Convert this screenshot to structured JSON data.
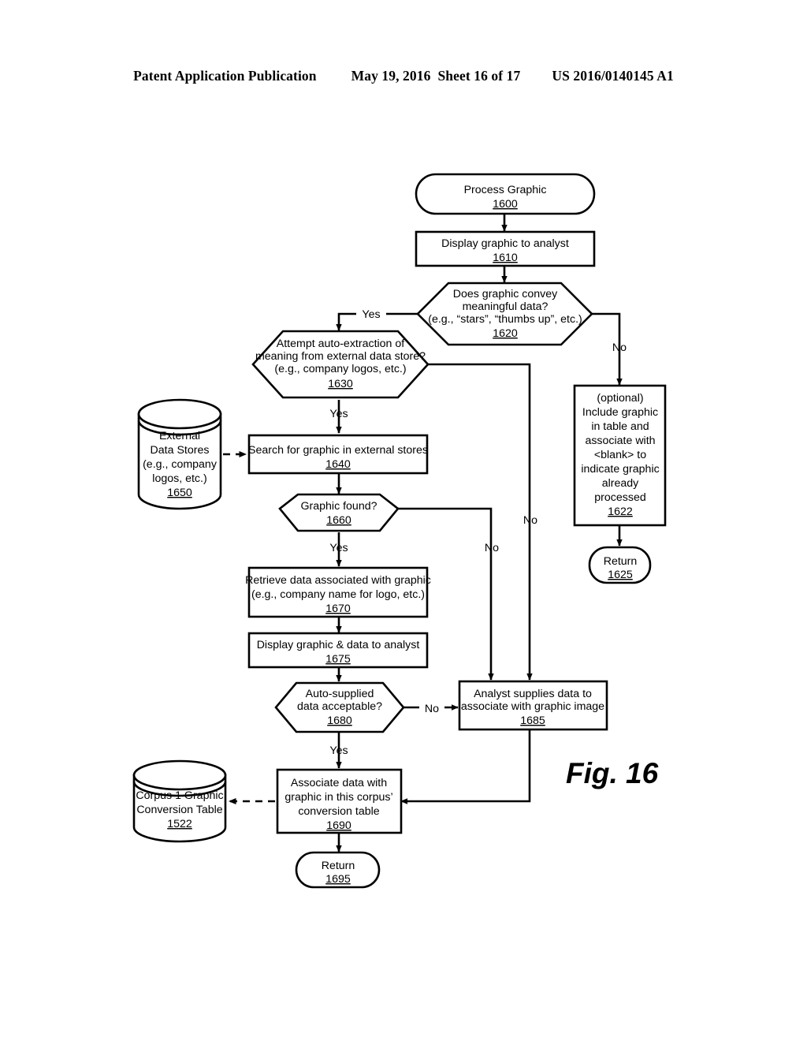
{
  "header": {
    "title": "Patent Application Publication",
    "date": "May 19, 2016",
    "sheet": "Sheet 16 of 17",
    "number": "US 2016/0140145 A1"
  },
  "figure": {
    "label": "Fig. 16"
  },
  "nodes": {
    "n1600": {
      "shape": "terminator",
      "lines": [
        "Process Graphic"
      ],
      "ref": "1600"
    },
    "n1610": {
      "shape": "process",
      "lines": [
        "Display graphic to analyst"
      ],
      "ref": "1610"
    },
    "n1620": {
      "shape": "decision",
      "lines": [
        "Does graphic convey",
        "meaningful data?",
        "(e.g., “stars”, “thumbs up”, etc.)"
      ],
      "ref": "1620"
    },
    "n1630": {
      "shape": "decision",
      "lines": [
        "Attempt auto-extraction of",
        "meaning from external data store?",
        "(e.g., company logos, etc.)"
      ],
      "ref": "1630"
    },
    "n1622": {
      "shape": "process",
      "lines": [
        "(optional)",
        "Include graphic",
        "in table and",
        "associate with",
        "<blank> to",
        "indicate graphic",
        "already",
        "processed"
      ],
      "ref": "1622"
    },
    "n1625": {
      "shape": "terminator",
      "lines": [
        "Return"
      ],
      "ref": "1625"
    },
    "n1650": {
      "shape": "datastore",
      "lines": [
        "External",
        "Data Stores",
        "(e.g., company",
        "logos, etc.)"
      ],
      "ref": "1650"
    },
    "n1640": {
      "shape": "process",
      "lines": [
        "Search for graphic in external stores"
      ],
      "ref": "1640"
    },
    "n1660": {
      "shape": "decision",
      "lines": [
        "Graphic found?"
      ],
      "ref": "1660"
    },
    "n1670": {
      "shape": "process",
      "lines": [
        "Retrieve data associated with graphic",
        "(e.g., company name for logo, etc.)"
      ],
      "ref": "1670"
    },
    "n1675": {
      "shape": "process",
      "lines": [
        "Display graphic & data to analyst"
      ],
      "ref": "1675"
    },
    "n1680": {
      "shape": "decision",
      "lines": [
        "Auto-supplied",
        "data acceptable?"
      ],
      "ref": "1680"
    },
    "n1685": {
      "shape": "process",
      "lines": [
        "Analyst supplies data to",
        "associate with graphic image"
      ],
      "ref": "1685"
    },
    "n1522": {
      "shape": "datastore",
      "lines": [
        "Corpus 1 Graphic",
        "Conversion Table"
      ],
      "ref": "1522"
    },
    "n1690": {
      "shape": "process",
      "lines": [
        "Associate data with",
        "graphic in this corpus’",
        "conversion table"
      ],
      "ref": "1690"
    },
    "n1695": {
      "shape": "terminator",
      "lines": [
        "Return"
      ],
      "ref": "1695"
    }
  },
  "edge_labels": {
    "e1620_yes": "Yes",
    "e1620_no": "No",
    "e1630_yes": "Yes",
    "e1630_no": "No",
    "e1660_yes": "Yes",
    "e1660_no": "No",
    "e1680_yes": "Yes",
    "e1680_no": "No"
  },
  "colors": {
    "ink": "#000000",
    "paper": "#ffffff"
  }
}
